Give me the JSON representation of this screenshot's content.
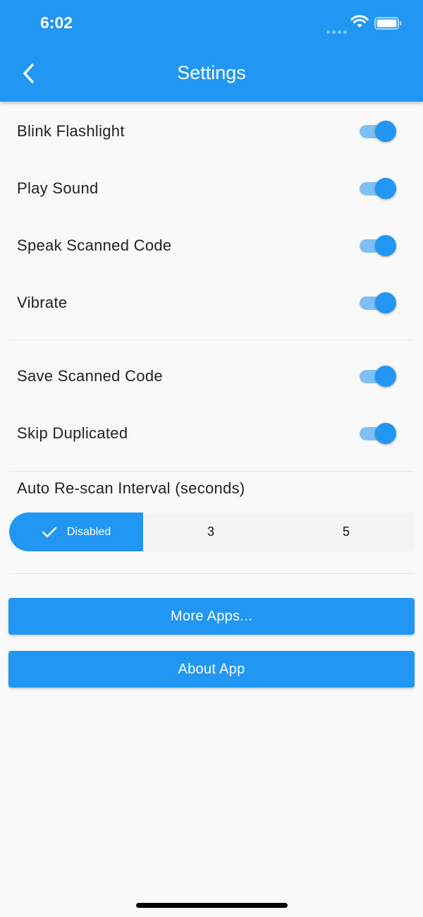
{
  "status_bar": {
    "time": "6:02"
  },
  "app_bar": {
    "title": "Settings"
  },
  "toggles_group1": [
    {
      "label": "Blink Flashlight",
      "on": true
    },
    {
      "label": "Play Sound",
      "on": true
    },
    {
      "label": "Speak Scanned Code",
      "on": true
    },
    {
      "label": "Vibrate",
      "on": true
    }
  ],
  "toggles_group2": [
    {
      "label": "Save Scanned Code",
      "on": true
    },
    {
      "label": "Skip Duplicated",
      "on": true
    }
  ],
  "rescan": {
    "label": "Auto Re-scan Interval (seconds)",
    "options": [
      "Disabled",
      "3",
      "5"
    ],
    "selected": "Disabled"
  },
  "buttons": {
    "more_apps": "More Apps...",
    "about_app": "About App"
  },
  "colors": {
    "accent": "#2196f3",
    "track_on": "#7fbff5",
    "background": "#f9f9f9"
  }
}
